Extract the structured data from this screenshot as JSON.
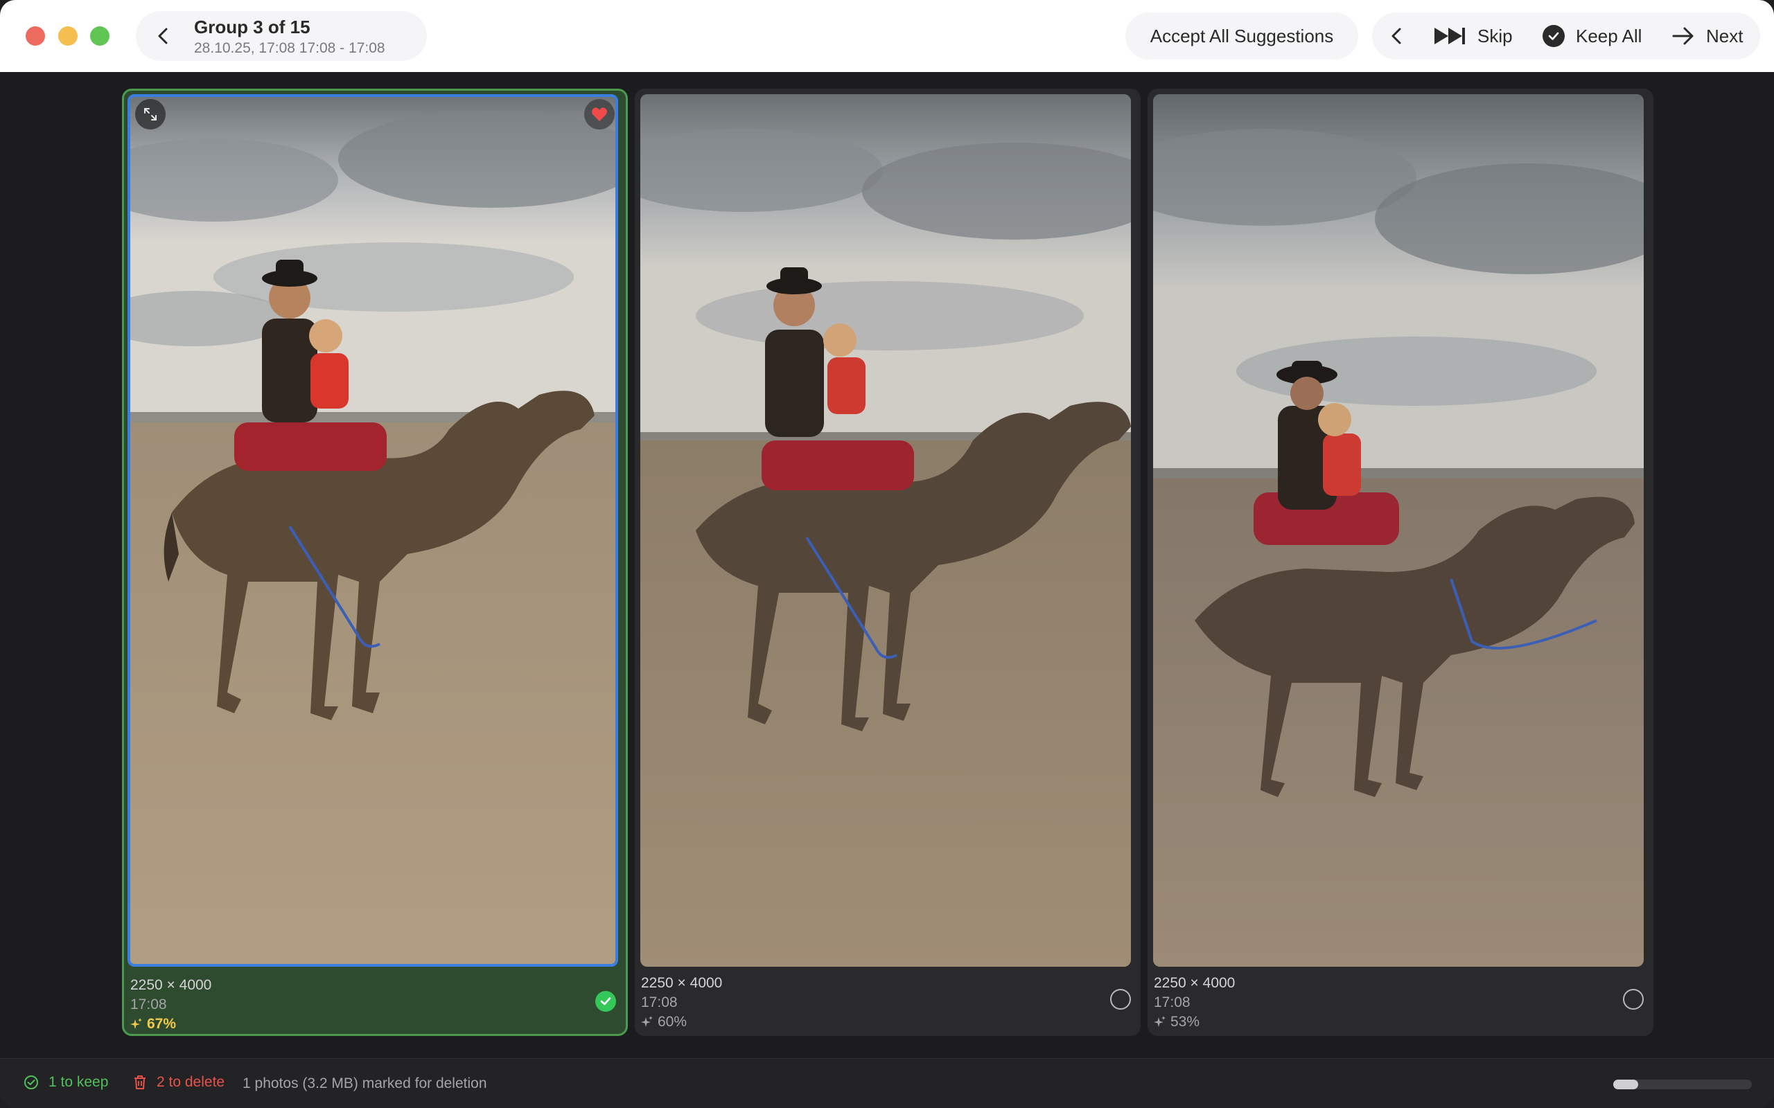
{
  "header": {
    "group_title": "Group 3 of 15",
    "group_subtitle": "28.10.25, 17:08 17:08 - 17:08",
    "accept_all": "Accept All Suggestions",
    "skip": "Skip",
    "keep_all": "Keep All",
    "next": "Next"
  },
  "photos": [
    {
      "dimensions": "2250 × 4000",
      "time": "17:08",
      "score": "67%",
      "selected": true,
      "favorite": true
    },
    {
      "dimensions": "2250 × 4000",
      "time": "17:08",
      "score": "60%",
      "selected": false,
      "favorite": false
    },
    {
      "dimensions": "2250 × 4000",
      "time": "17:08",
      "score": "53%",
      "selected": false,
      "favorite": false
    }
  ],
  "footer": {
    "keep_count": "1 to keep",
    "delete_count": "2 to delete",
    "marked_text": "1 photos (3.2 MB) marked for deletion",
    "scroll_position": 0.18
  },
  "colors": {
    "keep_green": "#4ec15a",
    "delete_red": "#e5534b",
    "score_highlight": "#f2c94c",
    "selection_blue": "#3a7fe0"
  }
}
